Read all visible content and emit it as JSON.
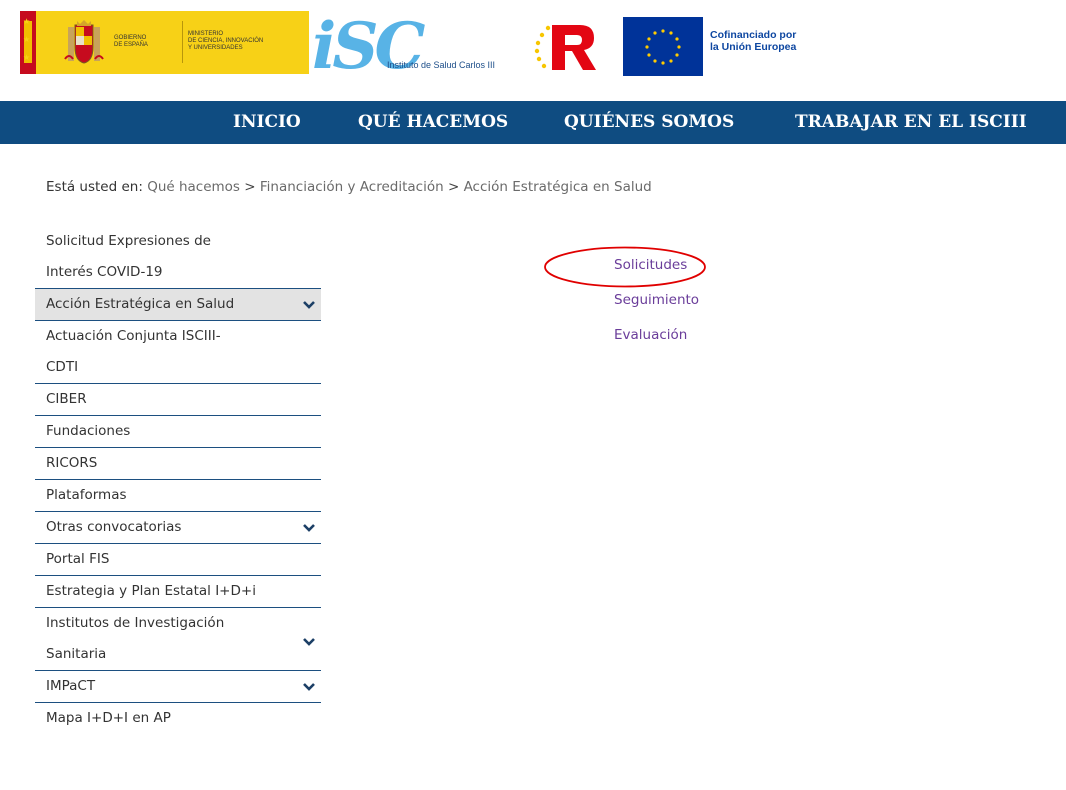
{
  "header": {
    "gov_line1": "GOBIERNO",
    "gov_line2": "DE ESPAÑA",
    "ministry_line1": "MINISTERIO",
    "ministry_line2": "DE CIENCIA, INNOVACIÓN",
    "ministry_line3": "Y UNIVERSIDADES",
    "isc_letters": "iSC",
    "isc_name": "Instituto de Salud Carlos III",
    "eu_line1": "Cofinanciado por",
    "eu_line2": "la Unión Europea",
    "colors": {
      "gov_yellow": "#f7d117",
      "isc_blue": "#58b3e6",
      "eu_blue": "#003399",
      "r_red": "#e30613"
    }
  },
  "nav": {
    "items": [
      "INICIO",
      "QUÉ HACEMOS",
      "QUIÉNES SOMOS",
      "TRABAJAR EN EL ISCIII"
    ],
    "color": "#0f4c81"
  },
  "breadcrumb": {
    "label": "Está usted en:",
    "crumbs": [
      "Qué hacemos",
      "Financiación y Acreditación",
      "Acción Estratégica en Salud"
    ],
    "separator": ">"
  },
  "sidemenu": {
    "items": [
      {
        "label1": "Solicitud Expresiones de",
        "label2": "Interés COVID-19"
      },
      {
        "label1": "Acción Estratégica en Salud",
        "icon": "chevron-down-icon",
        "active": true
      },
      {
        "label1": "Actuación Conjunta ISCIII-",
        "label2": "CDTI"
      },
      {
        "label1": "CIBER"
      },
      {
        "label1": "Fundaciones"
      },
      {
        "label1": "RICORS"
      },
      {
        "label1": "Plataformas"
      },
      {
        "label1": "Otras convocatorias",
        "icon": "chevron-down-icon"
      },
      {
        "label1": "Portal FIS"
      },
      {
        "label1": "Estrategia y Plan Estatal I+D+i"
      },
      {
        "label1": "Institutos de Investigación",
        "label2": "Sanitaria",
        "icon": "chevron-down-icon"
      },
      {
        "label1": "IMPaCT",
        "icon": "chevron-down-icon"
      },
      {
        "label1": "Mapa I+D+I en AP"
      }
    ]
  },
  "sublinks": [
    "Solicitudes",
    "Seguimiento",
    "Evaluación"
  ],
  "annotation": {
    "shape": "red-ellipse",
    "target": "Solicitudes",
    "color": "#e00000"
  }
}
